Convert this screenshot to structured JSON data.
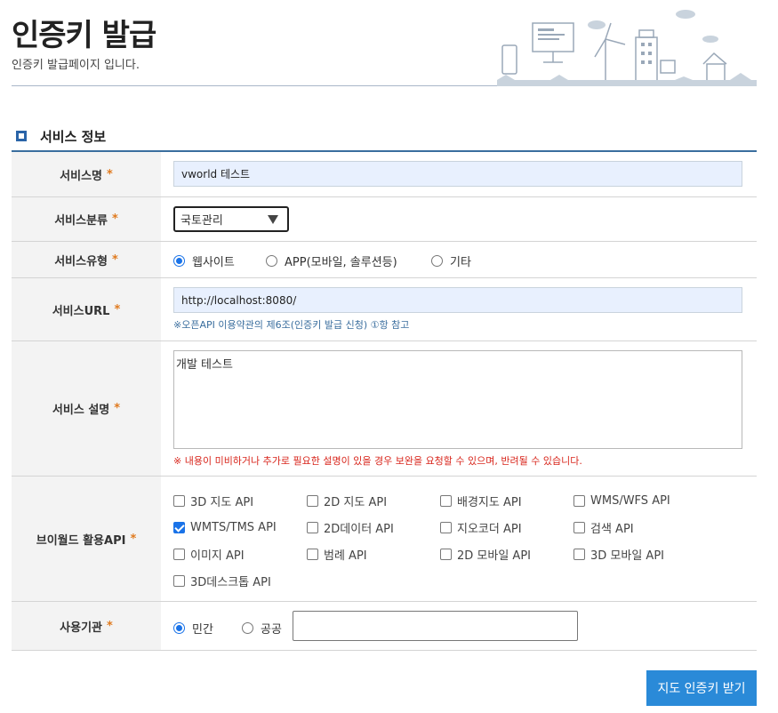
{
  "header": {
    "title": "인증키 발급",
    "description": "인증키 발급페이지 입니다."
  },
  "section": {
    "title": "서비스 정보"
  },
  "required_mark": "*",
  "form": {
    "service_name": {
      "label": "서비스명",
      "value": "vworld 테스트"
    },
    "service_category": {
      "label": "서비스분류",
      "selected": "국토관리"
    },
    "service_type": {
      "label": "서비스유형",
      "options": [
        "웹사이트",
        "APP(모바일, 솔루션등)",
        "기타"
      ],
      "checked": "웹사이트"
    },
    "service_url": {
      "label": "서비스URL",
      "value": "http://localhost:8080/",
      "hint": "※오픈API 이용약관의 제6조(인증키 발급 신청) ①항 참고"
    },
    "service_desc": {
      "label": "서비스 설명",
      "value": "개발 테스트",
      "warning": "※ 내용이 미비하거나 추가로 필요한 설명이 있을 경우 보완을 요청할 수 있으며, 반려될 수 있습니다."
    },
    "apis": {
      "label": "브이월드 활용API",
      "items": [
        {
          "label": "3D 지도 API",
          "checked": false
        },
        {
          "label": "2D 지도 API",
          "checked": false
        },
        {
          "label": "배경지도 API",
          "checked": false
        },
        {
          "label": "WMS/WFS API",
          "checked": false
        },
        {
          "label": "WMTS/TMS API",
          "checked": true
        },
        {
          "label": "2D데이터 API",
          "checked": false
        },
        {
          "label": "지오코더 API",
          "checked": false
        },
        {
          "label": "검색 API",
          "checked": false
        },
        {
          "label": "이미지 API",
          "checked": false
        },
        {
          "label": "범례 API",
          "checked": false
        },
        {
          "label": "2D 모바일 API",
          "checked": false
        },
        {
          "label": "3D 모바일 API",
          "checked": false
        },
        {
          "label": "3D데스크톱 API",
          "checked": false
        }
      ]
    },
    "organization": {
      "label": "사용기관",
      "options": [
        "민간",
        "공공"
      ],
      "checked": "민간",
      "value": ""
    }
  },
  "submit_label": "지도 인증키 받기",
  "colors": {
    "accent": "#2a8ad8",
    "radio": "#1a73e8",
    "required": "#e07a1e"
  }
}
